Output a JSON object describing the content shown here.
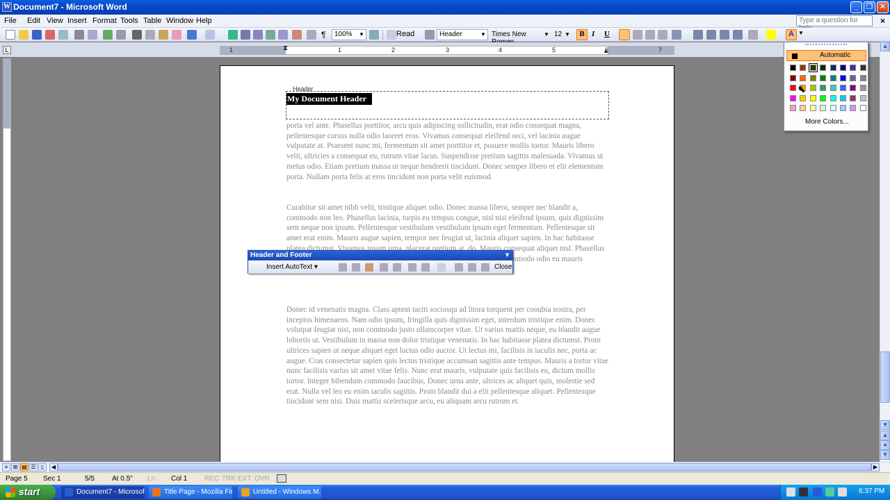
{
  "window": {
    "title": "Document7 - Microsoft Word"
  },
  "menu": {
    "items": [
      {
        "id": "file",
        "label": "File"
      },
      {
        "id": "edit",
        "label": "Edit"
      },
      {
        "id": "view",
        "label": "View"
      },
      {
        "id": "insert",
        "label": "Insert"
      },
      {
        "id": "format",
        "label": "Format"
      },
      {
        "id": "tools",
        "label": "Tools"
      },
      {
        "id": "table",
        "label": "Table"
      },
      {
        "id": "window",
        "label": "Window"
      },
      {
        "id": "help",
        "label": "Help"
      }
    ],
    "help_placeholder": "Type a question for help"
  },
  "toolbar": {
    "zoom": "100%",
    "read_label": "Read",
    "style": "Header",
    "font": "Times New Roman",
    "size": "12",
    "bold": "B",
    "italic": "I",
    "underline": "U"
  },
  "ruler": {
    "numbers": [
      "1",
      "1",
      "2",
      "3",
      "4",
      "5",
      "6",
      "7"
    ]
  },
  "document": {
    "header_tag": "Header",
    "header_text": "My Document Header",
    "paragraphs": [
      "porta vel ante. Phasellus porttitor, arcu quis adipiscing sollicitudin, erat odio consequat magna, pellentesque cursus nulla odio laoreet eros. Vivamus consequat eleifend orci, vel lacinia augue vulputate at. Praesent nunc mi, fermentum sit amet porttitor et, posuere mollis tortor. Mauris libero velit, ultricies a consequat eu, rutrum vitae lacus. Suspendisse pretium sagittis malesuada. Vivamus ut metus odio. Etiam pretium massa ut neque hendrerit tincidunt. Donec semper libero et elit elementum porta. Nullam porta felis at eros tincidunt non porta velit euismod.",
      "Curabitur sit amet nibh velit, tristique aliquet odio. Donec massa libero, semper nec blandit a, commodo non leo. Phasellus lacinia, turpis eu tempus congue, nisl nisi eleifend ipsum, quis dignissim sem neque non ipsum. Pellentesque vestibulum vestibulum ipsum eget fermentum. Pellentesque sit amet erat enim. Mauris augue sapien, tempor nec feugiat ut, lacinia aliquet sapien. In hac habitasse platea dictumst. Vivamus ipsum urna, placerat pretium at, do. Mauris consequat aliquet nisl. Phasellus ac dolor mauris. Nulla luctus convallis metus luctus venenatis. Etiam commodo odio eu mauris volutpat vel fringilla elit dictum.",
      "Donec id venenatis magna. Class aptent taciti sociosqu ad litora torquent per conubia nostra, per inceptos himenaeos. Nam odio ipsum, fringilla quis dignissim eget, interdum tristique enim. Donec volutpat feugiat nisi, non commodo justo ullamcorper vitae. Ut varius mattis neque, eu blandit augue lobortis ut. Vestibulum in massa non dolor tristique venenatis. In hac habitasse platea dictumst. Proin ultrices sapien ut neque aliquet eget luctus odio auctor. Ut lectus mi, facilisis in iaculis nec, porta ac augue. Cras consectetur sapien quis lectus tristique accumsan sagittis ante tempus. Mauris a tortor vitae nunc facilisis varius sit amet vitae felis. Nunc erat mauris, vulputate quis facilisis eu, dictum mollis tortor. Integer bibendum commodo faucibus. Donec urna ante, ultrices ac aliquet quis, molestie sed erat. Nulla vel leo eu enim iaculis sagittis. Proin blandit dui a elit pellentesque aliquet. Pellentesque tincidunt sem nisi. Duis mattis scelerisque arcu, eu aliquam arcu rutrum et."
    ]
  },
  "hf_toolbar": {
    "title": "Header and Footer",
    "insert_autotext": "Insert AutoText",
    "close": "Close"
  },
  "color_popup": {
    "automatic": "Automatic",
    "more_colors": "More Colors...",
    "rows": [
      [
        "#000000",
        "#993300",
        "#333300",
        "#003300",
        "#003366",
        "#000080",
        "#333399",
        "#333333"
      ],
      [
        "#800000",
        "#FF6600",
        "#808000",
        "#008000",
        "#008080",
        "#0000FF",
        "#666699",
        "#808080"
      ],
      [
        "#FF0000",
        "#FF9900",
        "#99CC00",
        "#339966",
        "#33CCCC",
        "#3366FF",
        "#800080",
        "#969696"
      ],
      [
        "#FF00FF",
        "#FFCC00",
        "#FFFF00",
        "#00FF00",
        "#00FFFF",
        "#00CCFF",
        "#993366",
        "#C0C0C0"
      ],
      [
        "#FF99CC",
        "#FFCC99",
        "#FFFF99",
        "#CCFFCC",
        "#CCFFFF",
        "#99CCFF",
        "#CC99FF",
        "#FFFFFF"
      ]
    ]
  },
  "status": {
    "page": "Page 5",
    "sec": "Sec 1",
    "pages": "5/5",
    "at": "At 0.5\"",
    "ln": "Ln",
    "col": "Col 1",
    "rec": "REC",
    "trk": "TRK",
    "ext": "EXT",
    "ovr": "OVR"
  },
  "taskbar": {
    "start": "start",
    "tasks": [
      {
        "label": "Document7 - Microsof...",
        "color": "#2b5bd0",
        "active": true
      },
      {
        "label": "Title Page - Mozilla Fir...",
        "color": "#e8731a",
        "active": false
      },
      {
        "label": "Untitled - Windows M...",
        "color": "#e8a41a",
        "active": false
      }
    ],
    "clock": "6:37 PM"
  }
}
